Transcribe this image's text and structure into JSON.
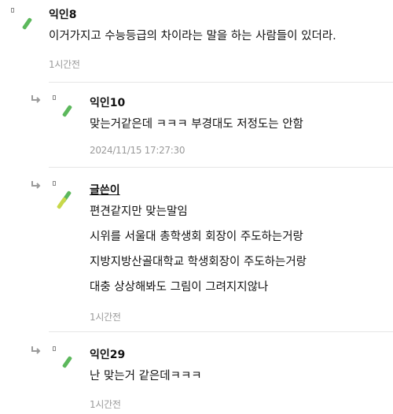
{
  "comments": [
    {
      "author": "익인8",
      "lines": [
        "이거가지고 수능등급의 차이라는 말을 하는 사람들이 있더라."
      ],
      "meta": "1시간전",
      "accent": "#5cb85c"
    },
    {
      "author": "익인10",
      "lines": [
        "맞는거같은데 ㅋㅋㅋ 부경대도 저정도는 안함"
      ],
      "meta": "2024/11/15 17:27:30",
      "accent": "#5cb85c"
    },
    {
      "author": "글쓴이",
      "lines": [
        "편견같지만 맞는말임",
        "시위를 서울대 총학생회 회장이 주도하는거랑",
        "지방지방산골대학교 학생회장이 주도하는거랑",
        "대충 상상해봐도 그림이 그려지지않나"
      ],
      "meta": "1시간전",
      "accent": "#c8d84a",
      "accent2": "#5cb85c"
    },
    {
      "author": "익인29",
      "lines": [
        "난 맞는거 같은데ㅋㅋㅋ"
      ],
      "meta": "1시간전",
      "accent": "#5cb85c"
    }
  ],
  "icons": {
    "reply": "reply-arrow-icon",
    "avatar": "avatar-icon"
  }
}
